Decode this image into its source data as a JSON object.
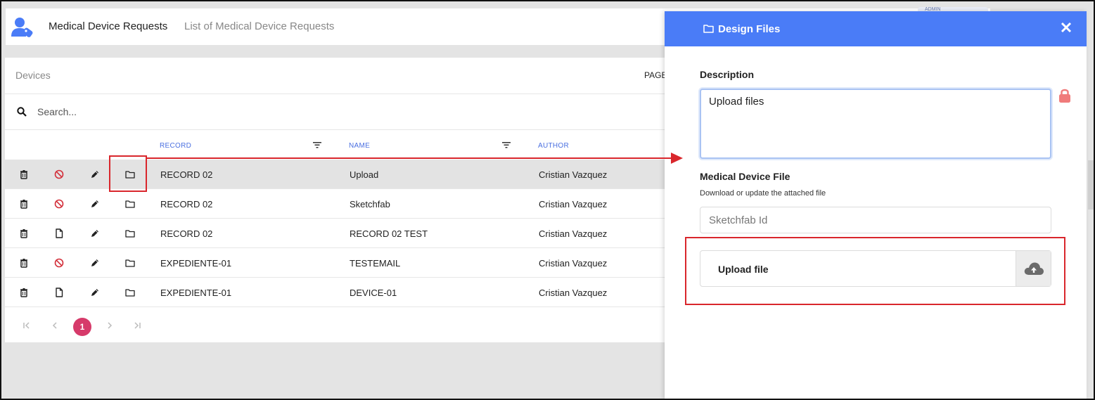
{
  "header": {
    "title": "Medical Device Requests",
    "subtitle": "List of Medical Device Requests",
    "badge": "ADMIN"
  },
  "card": {
    "title": "Devices",
    "pages_label": "PAGE",
    "search_placeholder": "Search...",
    "columns": {
      "record": "RECORD",
      "name": "NAME",
      "author": "AUTHOR"
    }
  },
  "rows": [
    {
      "record": "RECORD 02",
      "name": "Upload",
      "author": "Cristian Vazquez",
      "status_icon": "block-icon",
      "selected": true
    },
    {
      "record": "RECORD 02",
      "name": "Sketchfab",
      "author": "Cristian Vazquez",
      "status_icon": "block-icon",
      "selected": false
    },
    {
      "record": "RECORD 02",
      "name": "RECORD 02 TEST",
      "author": "Cristian Vazquez",
      "status_icon": "file-icon",
      "selected": false
    },
    {
      "record": "EXPEDIENTE-01",
      "name": "TESTEMAIL",
      "author": "Cristian Vazquez",
      "status_icon": "block-icon",
      "selected": false
    },
    {
      "record": "EXPEDIENTE-01",
      "name": "DEVICE-01",
      "author": "Cristian Vazquez",
      "status_icon": "file-icon",
      "selected": false
    }
  ],
  "pagination": {
    "current_page": "1"
  },
  "modal": {
    "title": "Design Files",
    "description_label": "Description",
    "description_value": "Upload files",
    "file_label": "Medical Device File",
    "file_hint": "Download or update the attached file",
    "sketchfab_placeholder": "Sketchfab Id",
    "upload_label": "Upload file"
  },
  "colors": {
    "accent": "#4a7cf7",
    "column_header": "#4a6fe0",
    "page_badge": "#d63a6a",
    "annotation": "#d9262c",
    "block_icon": "#d32f3a",
    "lock_icon": "#f07b7b"
  }
}
